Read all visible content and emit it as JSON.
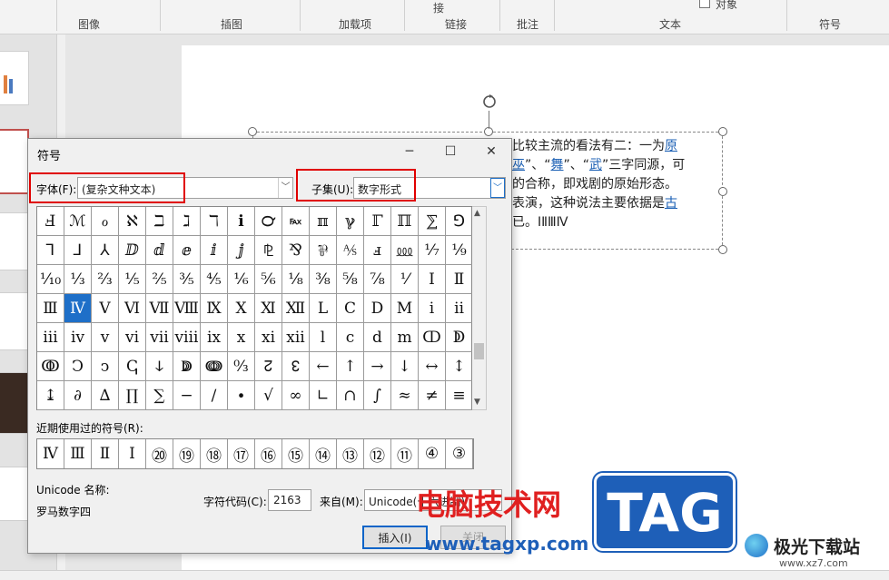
{
  "ribbon": {
    "groups": [
      "图像",
      "插图",
      "加载项",
      "链接",
      "批注",
      "文本",
      "符号"
    ],
    "top_labels": [
      "接",
      "对象"
    ]
  },
  "slide": {
    "lines": [
      {
        "text": "比较主流的看法有二：一为",
        "link": "原"
      },
      {
        "pre": "巫",
        "mid1": "”、“",
        "l2": "舞",
        "mid2": "”、“",
        "l3": "武",
        "tail": "”三字同源，可"
      },
      {
        "text": "的合称，即戏剧的原始形态。"
      },
      {
        "text": "表演，这种说法主要依据是",
        "link": "古"
      },
      {
        "text": "已。ⅠⅡⅢⅣ"
      }
    ]
  },
  "dialog": {
    "title": "符号",
    "font_label": "字体(F):",
    "font_value": "(复杂文种文本)",
    "subset_label": "子集(U):",
    "subset_value": "数字形式",
    "symbols": [
      "Ⅎ",
      "ℳ",
      "ℴ",
      "ℵ",
      "ℶ",
      "ℷ",
      "ℸ",
      "ℹ",
      "℺",
      "℻",
      "ℼ",
      "ℽ",
      "ℾ",
      "ℿ",
      "⅀",
      "⅁",
      "⅂",
      "⅃",
      "⅄",
      "ⅅ",
      "ⅆ",
      "ⅇ",
      "ⅈ",
      "ⅉ",
      "⅊",
      "⅋",
      "⅌",
      "⅍",
      "ⅎ",
      "⅏",
      "⅐",
      "⅑",
      "⅒",
      "⅓",
      "⅔",
      "⅕",
      "⅖",
      "⅗",
      "⅘",
      "⅙",
      "⅚",
      "⅛",
      "⅜",
      "⅝",
      "⅞",
      "⅟",
      "Ⅰ",
      "Ⅱ",
      "Ⅲ",
      "Ⅳ",
      "Ⅴ",
      "Ⅵ",
      "Ⅶ",
      "Ⅷ",
      "Ⅸ",
      "Ⅹ",
      "Ⅺ",
      "Ⅻ",
      "Ⅼ",
      "Ⅽ",
      "Ⅾ",
      "Ⅿ",
      "ⅰ",
      "ⅱ",
      "ⅲ",
      "ⅳ",
      "ⅴ",
      "ⅵ",
      "ⅶ",
      "ⅷ",
      "ⅸ",
      "ⅹ",
      "ⅺ",
      "ⅻ",
      "ⅼ",
      "ⅽ",
      "ⅾ",
      "ⅿ",
      "ↀ",
      "ↁ",
      "ↂ",
      "Ↄ",
      "ↄ",
      "ↅ",
      "ↆ",
      "ↇ",
      "ↈ",
      "↉",
      "↊",
      "↋",
      "←",
      "↑",
      "→",
      "↓",
      "↔",
      "↕",
      "↨",
      "∂",
      "∆",
      "∏",
      "∑",
      "−",
      "∕",
      "∙",
      "√",
      "∞",
      "∟",
      "∩",
      "∫",
      "≈",
      "≠",
      "≡"
    ],
    "selected_index": 49,
    "recent_label": "近期使用过的符号(R):",
    "recent": [
      "Ⅳ",
      "Ⅲ",
      "Ⅱ",
      "Ⅰ",
      "⑳",
      "⑲",
      "⑱",
      "⑰",
      "⑯",
      "⑮",
      "⑭",
      "⑬",
      "⑫",
      "⑪",
      "④",
      "③"
    ],
    "unicode_name_label": "Unicode 名称:",
    "unicode_name_value": "罗马数字四",
    "char_code_label": "字符代码(C):",
    "char_code_value": "2163",
    "from_label": "来自(M):",
    "from_value": "Unicode(十六进制)",
    "insert_label": "插入(I)",
    "cancel_label": "关闭"
  },
  "watermark": {
    "text": "电脑技术网",
    "url": "www.tagxp.com",
    "tag": "TAG",
    "logo": "极光下载站",
    "logo_url": "www.xz7.com"
  },
  "colors": {
    "accent": "#1e6fc8",
    "highlight": "#e00000",
    "link": "#1a5fb4"
  }
}
